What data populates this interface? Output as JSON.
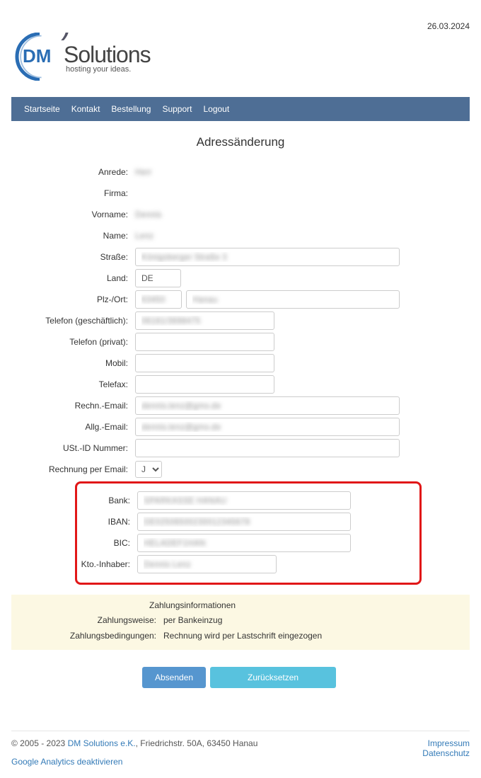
{
  "header": {
    "date": "26.03.2024",
    "logo": {
      "dm": "DM",
      "solutions": "Solutions",
      "tagline": "hosting your ideas."
    }
  },
  "nav": {
    "items": [
      "Startseite",
      "Kontakt",
      "Bestellung",
      "Support",
      "Logout"
    ]
  },
  "page_title": "Adressänderung",
  "fields": {
    "anrede": {
      "label": "Anrede:",
      "value": "Herr"
    },
    "firma": {
      "label": "Firma:",
      "value": ""
    },
    "vorname": {
      "label": "Vorname:",
      "value": "Dennis"
    },
    "name": {
      "label": "Name:",
      "value": "Lenz"
    },
    "strasse": {
      "label": "Straße:",
      "value": "Königsberger Straße 3"
    },
    "land": {
      "label": "Land:",
      "value": "DE"
    },
    "plz_ort": {
      "label": "Plz-/Ort:",
      "plz": "63450",
      "ort": "Hanau"
    },
    "tel_geschaeft": {
      "label": "Telefon (geschäftlich):",
      "value": "06181/3698475"
    },
    "tel_privat": {
      "label": "Telefon (privat):",
      "value": ""
    },
    "mobil": {
      "label": "Mobil:",
      "value": ""
    },
    "telefax": {
      "label": "Telefax:",
      "value": ""
    },
    "rechn_email": {
      "label": "Rechn.-Email:",
      "value": "dennis.lenz@gmx.de"
    },
    "allg_email": {
      "label": "Allg.-Email:",
      "value": "dennis.lenz@gmx.de"
    },
    "ust_id": {
      "label": "USt.-ID Nummer:",
      "value": ""
    },
    "rechnung_per_email": {
      "label": "Rechnung per Email:",
      "value": "J"
    },
    "bank": {
      "label": "Bank:",
      "value": "SPARKASSE HANAU"
    },
    "iban": {
      "label": "IBAN:",
      "value": "DE02506500230012345678"
    },
    "bic": {
      "label": "BIC:",
      "value": "HELADEF1HAN"
    },
    "kto_inhaber": {
      "label": "Kto.-Inhaber:",
      "value": "Dennis Lenz"
    }
  },
  "payment_info": {
    "title": "Zahlungsinformationen",
    "rows": [
      {
        "label": "Zahlungsweise:",
        "value": "per Bankeinzug"
      },
      {
        "label": "Zahlungsbedingungen:",
        "value": "Rechnung wird per Lastschrift eingezogen"
      }
    ]
  },
  "buttons": {
    "submit": "Absenden",
    "reset": "Zurücksetzen"
  },
  "footer": {
    "copyright_prefix": "© 2005 - 2023 ",
    "company": "DM Solutions e.K.",
    "address": ", Friedrichstr. 50A, 63450 Hanau",
    "impressum": "Impressum",
    "datenschutz": "Datenschutz",
    "analytics": "Google Analytics deaktivieren"
  }
}
